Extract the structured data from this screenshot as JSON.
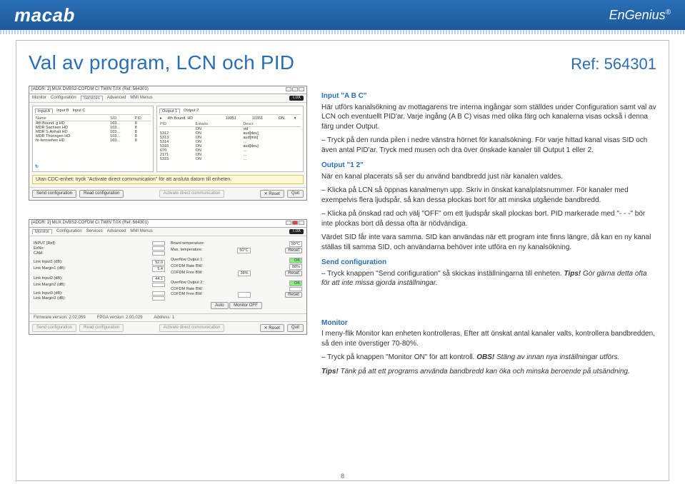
{
  "header": {
    "logo_left": "macab",
    "logo_right": "EnGenius"
  },
  "page": {
    "title": "Val av program, LCN och PID",
    "ref": "Ref: 564301",
    "page_number": "8"
  },
  "screenshot1": {
    "window_title": "[ADDR: 2] MUX DVBS2-COFDM CI TWIN T.0X (Ref: 564301)",
    "brand_badge": "T.0X",
    "tabs": [
      "Monitor",
      "Configuration",
      "Services",
      "Advanced",
      "MMI Menus"
    ],
    "input_panel": {
      "tabs": [
        "Input A",
        "Input B",
        "Input C"
      ],
      "columns": [
        "Name",
        "SID",
        "PID"
      ],
      "rows": [
        [
          "4th Bound. g HD",
          "103…",
          "8"
        ],
        [
          "MDR Sachsen HD",
          "103…",
          "8"
        ],
        [
          "MDR S-Anhalt HD",
          "103…",
          "8"
        ],
        [
          "MDR Thüringen HD",
          "103…",
          "8"
        ],
        [
          "hr-fernsehen HD",
          "103…",
          "8"
        ]
      ]
    },
    "output_panel": {
      "tabs": [
        "Output 1",
        "Output 2"
      ],
      "top_row": [
        "",
        "4th Bound. HD",
        "10351",
        "10351",
        "ON",
        ""
      ],
      "columns": [
        "PID",
        "Estado",
        "Descr"
      ],
      "rows": [
        [
          "",
          "ON",
          "vid"
        ],
        [
          "5312",
          "ON",
          "aud[deu]"
        ],
        [
          "5313",
          "ON",
          "aud[mis]"
        ],
        [
          "5314",
          "ON",
          "…"
        ],
        [
          "5316",
          "ON",
          "aud[deu]"
        ],
        [
          "670",
          "ON",
          "…"
        ],
        [
          "2171",
          "ON",
          "…"
        ],
        [
          "5315",
          "ON",
          "…"
        ]
      ]
    },
    "hint": "Utan CDC-enhet: tryck \"Activate direct communication\" för att ansluta datorn till enheten.",
    "buttons": {
      "send": "Send configuration",
      "read": "Read configuration",
      "activate": "Activate direct communication",
      "reset": "Reset",
      "quit": "Quit"
    }
  },
  "screenshot2": {
    "window_title": "[ADDR: 2] MUX DVBS2-COFDM CI TWIN T.0X (Ref: 564301)",
    "tabs": [
      "Monitor",
      "Configuration",
      "Services",
      "Advanced",
      "MMI Menus"
    ],
    "left": {
      "rows": [
        [
          "INPUT [Ref]:",
          ""
        ],
        [
          "EsNo:",
          ""
        ],
        [
          "CAM:",
          ""
        ],
        [
          "Link Input1 (dB):",
          "52.0"
        ],
        [
          "Link Margin1 (dB):",
          "5.4"
        ],
        [
          "Link Input2 (dB):",
          "44.1"
        ],
        [
          "Link Margin2 (dB):",
          ""
        ],
        [
          "Link Input3 (dB):",
          ""
        ],
        [
          "Link Margin3 (dB):",
          ""
        ]
      ]
    },
    "right": {
      "rows": [
        [
          "Board temperature:",
          "50°C"
        ],
        [
          "Max. temperature:",
          "50°C",
          "Reset"
        ],
        [
          "Overflow Output 1:",
          "OK"
        ],
        [
          "COFDM Rate BW:",
          "88%"
        ],
        [
          "COFDM Free BW:",
          "38%",
          "Reset"
        ],
        [
          "Overflow Output 2:",
          "OK"
        ],
        [
          "COFDM Rate BW:",
          ""
        ],
        [
          "COFDM Free BW:",
          "",
          "Reset"
        ]
      ],
      "monitor_btns": [
        "Auto",
        "Monitor OFF"
      ]
    },
    "statusbar": {
      "fw": "Firmware version: 2.02.059",
      "fpga": "FPGA version: 2.00.029",
      "addr": "Address: 1"
    },
    "buttons": {
      "send": "Send configuration",
      "read": "Read configuration",
      "activate": "Activate direct communication",
      "reset": "Reset",
      "quit": "Quit"
    }
  },
  "text": {
    "s1_head": "Input \"A B C\"",
    "s1_p1": "Här utförs kanalsökning av mottagarens tre interna ingångar som ställdes under Configuration samt val av LCN och eventuellt PID'ar. Varje ingång (A B C) visas med olika färg och kanalerna visas också i denna färg under Output.",
    "s1_p2": "– Tryck på den runda pilen i nedre vänstra hörnet för kanalsökning. För varje hittad kanal visas SID och även antal PID'ar. Tryck med musen och dra över önskade kanaler till Output 1 eller 2.",
    "s2_head": "Output \"1 2\"",
    "s2_p1": "När en kanal placerats så ser du använd bandbredd just när kanalen valdes.",
    "s2_p2": "– Klicka på LCN så öppnas kanalmenyn upp. Skriv in önskat kanalplatsnummer. För kanaler med exempelvis flera ljudspår, så kan dessa plockas bort för att minska utgående bandbredd.",
    "s2_p3": "– Klicka på önskad rad och välj \"OFF\" om ett ljudspår skall plockas bort. PID markerade med \"- - -\" bör inte plockas bort då dessa ofta är nödvändiga.",
    "s2_p4": "Värdet SID får inte vara samma. SID kan användas när ett program inte finns längre, då kan en ny kanal ställas till samma SID, och användarna behöver inte utföra en ny kanalsökning.",
    "s3_head": "Send configuration",
    "s3_p1a": "– Tryck knappen \"Send configuration\" så skickas inställningarna till enheten. ",
    "s3_p1_tips": "Tips!",
    "s3_p1b": " Gör gärna detta ofta för att inte missa gjorda inställningar.",
    "s4_head": "Monitor",
    "s4_p1": "I meny-flik Monitor kan enheten kontrolleras. Efter att önskat antal kanaler valts, kontrollera bandbredden, så den inte överstiger 70-80%.",
    "s4_p2a": "– Tryck på knappen \"Monitor ON\" för att kontroll. ",
    "s4_p2_obs": "OBS!",
    "s4_p2b": " Stäng av innan nya inställningar utförs.",
    "s4_p3_tips": "Tips!",
    "s4_p3": " Tänk på att ett programs använda bandbredd kan öka och minska beroende på utsändning."
  }
}
